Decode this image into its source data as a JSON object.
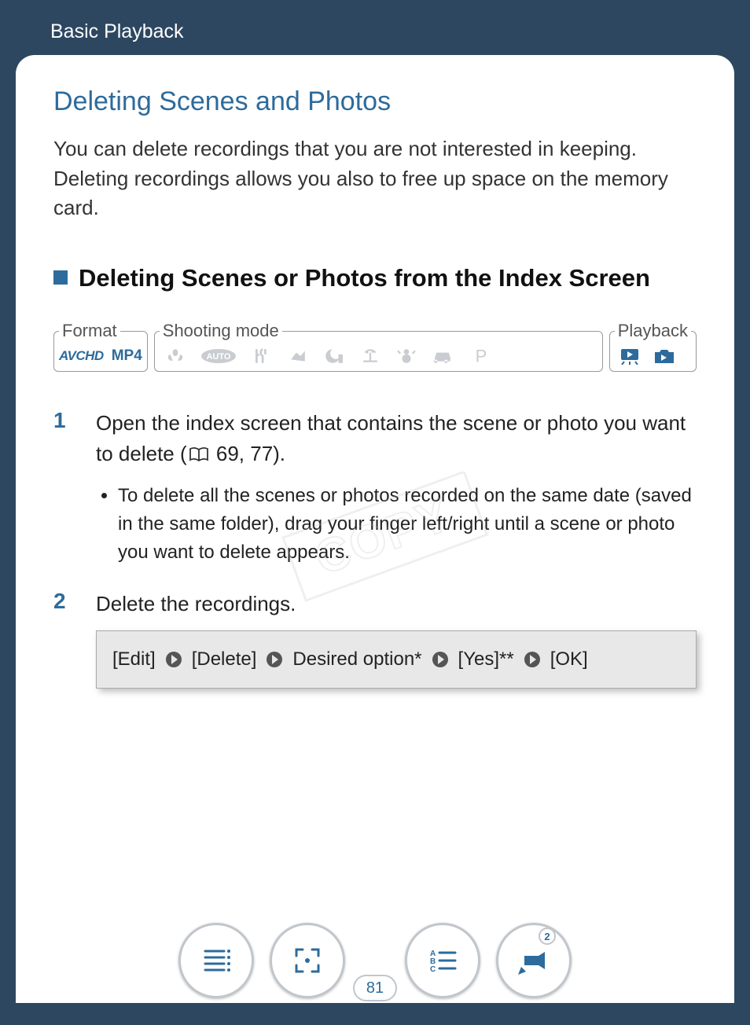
{
  "header": {
    "section": "Basic Playback"
  },
  "title": "Deleting Scenes and Photos",
  "intro": "You can delete recordings that you are not interested in keeping. Deleting recordings allows you also to free up space on the memory card.",
  "subheading": "Deleting Scenes or Photos from the Index Screen",
  "mode_groups": {
    "format": {
      "legend": "Format",
      "items": [
        "AVCHD",
        "MP4"
      ]
    },
    "shooting": {
      "legend": "Shooting mode"
    },
    "playback": {
      "legend": "Playback"
    }
  },
  "steps": {
    "s1": {
      "num": "1",
      "text_a": "Open the index screen that contains the scene or photo you want to delete (",
      "pages": " 69, 77).",
      "bullet": "To delete all the scenes or photos recorded on the same date (saved in the same folder), drag your finger left/right until a scene or photo you want to delete appears."
    },
    "s2": {
      "num": "2",
      "text": "Delete the recordings.",
      "proc": {
        "p1": "[Edit]",
        "p2": "[Delete]",
        "p3": "Desired option*",
        "p4": "[Yes]**",
        "p5": "[OK]"
      }
    }
  },
  "page_number": "81",
  "nav_badge": "2",
  "watermark": "COPY"
}
